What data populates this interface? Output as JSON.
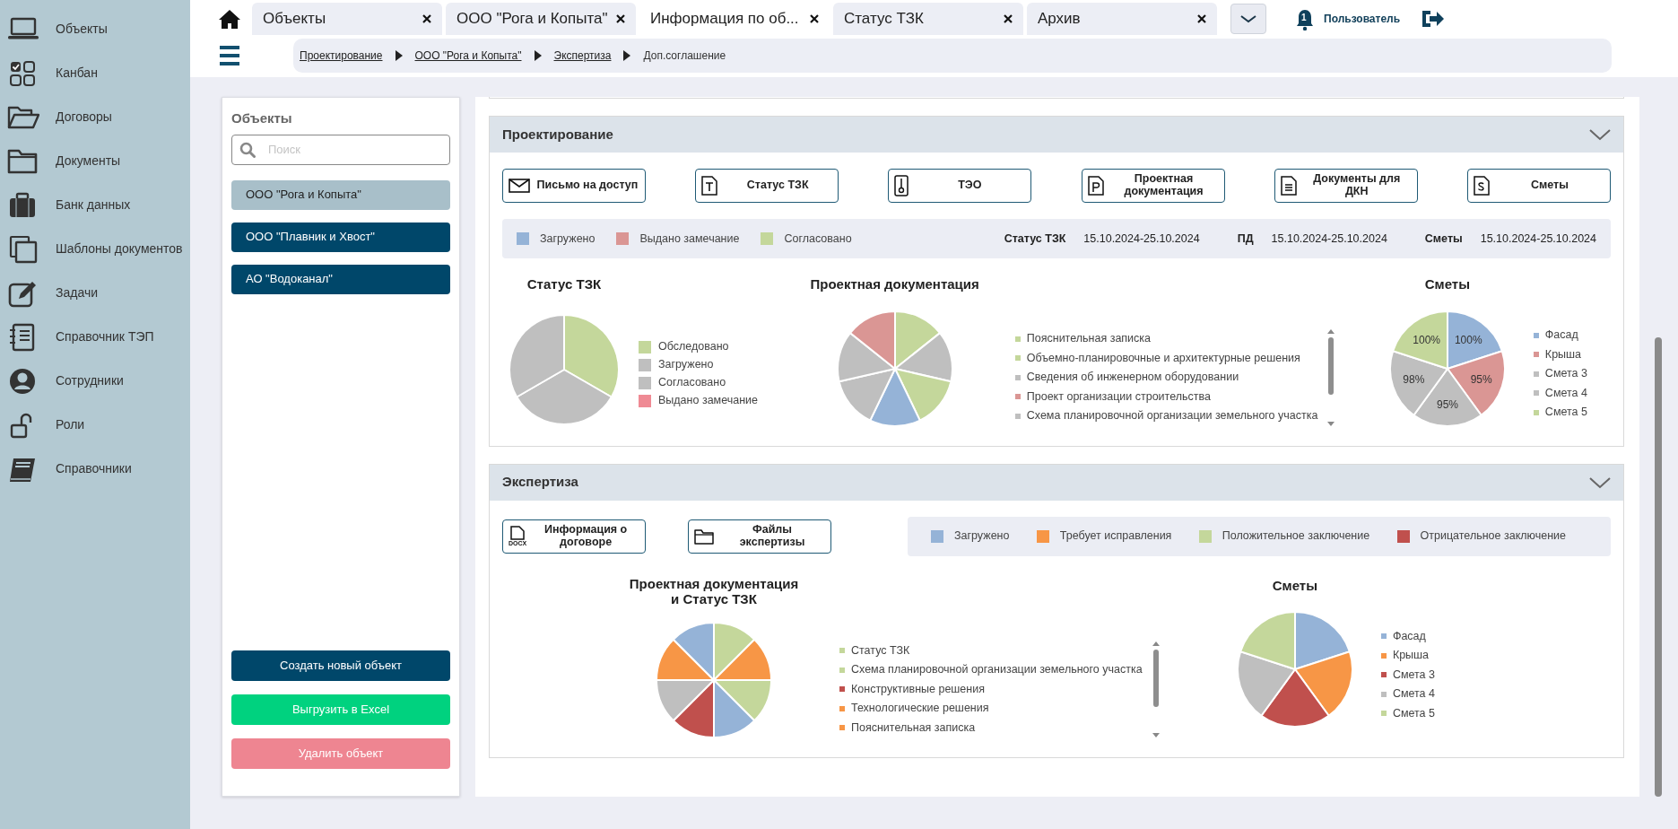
{
  "sidebar": {
    "items": [
      {
        "label": "Объекты"
      },
      {
        "label": "Канбан"
      },
      {
        "label": "Договоры"
      },
      {
        "label": "Документы"
      },
      {
        "label": "Банк данных"
      },
      {
        "label": "Шаблоны документов"
      },
      {
        "label": "Задачи"
      },
      {
        "label": "Справочник ТЭП"
      },
      {
        "label": "Сотрудники"
      },
      {
        "label": "Роли"
      },
      {
        "label": "Справочники"
      }
    ]
  },
  "tabs": [
    {
      "label": "Объекты",
      "selected": false
    },
    {
      "label": "ООО \"Рога и Копыта\"",
      "selected": false
    },
    {
      "label": "Информация по об...",
      "selected": true
    },
    {
      "label": "Статус ТЗК",
      "selected": false
    },
    {
      "label": "Архив",
      "selected": false
    }
  ],
  "header": {
    "notification_count": "1",
    "user": "Пользователь"
  },
  "breadcrumbs": [
    {
      "label": "Проектирование",
      "kind": "link"
    },
    {
      "label": "ООО \"Рога и Копыта\"",
      "kind": "link"
    },
    {
      "label": "Экспертиза",
      "kind": "link"
    },
    {
      "label": "Доп.соглашение",
      "kind": "current"
    }
  ],
  "objects_panel": {
    "title": "Объекты",
    "search": {
      "placeholder": "Поиск"
    },
    "items": [
      {
        "label": "ООО \"Рога и Копыта\"",
        "selected": true
      },
      {
        "label": "ООО \"Плавник и Хвост\"",
        "selected": false
      },
      {
        "label": "АО \"Водоканал\"",
        "selected": false
      }
    ],
    "actions": [
      {
        "label": "Создать новый объект",
        "kind": "primary"
      },
      {
        "label": "Выгрузить в Excel",
        "kind": "success"
      },
      {
        "label": "Удалить объект",
        "kind": "danger"
      }
    ]
  },
  "sections": [
    {
      "title": "Проектирование",
      "expanded": true,
      "buttons": [
        {
          "label": "Письмо на доступ"
        },
        {
          "label": "Статус ТЗК"
        },
        {
          "label": "ТЭО"
        },
        {
          "label": "Проектная документация"
        },
        {
          "label": "Документы для ДКН"
        },
        {
          "label": "Сметы"
        }
      ],
      "legend": [
        {
          "label": "Загружено",
          "color": "#95b3d7"
        },
        {
          "label": "Выдано замечание",
          "color": "#da9694"
        },
        {
          "label": "Согласовано",
          "color": "#c4d79b"
        }
      ],
      "periods": [
        {
          "label": "Статус ТЗК",
          "value": "15.10.2024-25.10.2024"
        },
        {
          "label": "ПД",
          "value": "15.10.2024-25.10.2024"
        },
        {
          "label": "Сметы",
          "value": "15.10.2024-25.10.2024"
        }
      ],
      "charts": [
        {
          "title": "Статус ТЗК",
          "kind": "block",
          "scrollable": false,
          "slices": [
            {
              "color": "#c4d79b"
            },
            {
              "color": "#bfbfbf"
            },
            {
              "color": "#bfbfbf"
            }
          ],
          "legend": [
            {
              "label": "Обследовано",
              "color": "#c4d79b"
            },
            {
              "label": "Загружено",
              "color": "#bfbfbf"
            },
            {
              "label": "Согласовано",
              "color": "#bfbfbf"
            },
            {
              "label": "Выдано замечание",
              "color": "#ef8a94"
            }
          ]
        },
        {
          "title": "Проектная документация",
          "kind": "list",
          "scrollable": true,
          "slices": [
            {
              "color": "#c4d79b"
            },
            {
              "color": "#bfbfbf"
            },
            {
              "color": "#c4d79b"
            },
            {
              "color": "#95b3d7"
            },
            {
              "color": "#bfbfbf"
            },
            {
              "color": "#bfbfbf"
            },
            {
              "color": "#da9694"
            }
          ],
          "legend": [
            {
              "label": "Пояснительная записка",
              "color": "#c4d79b"
            },
            {
              "label": "Объемно-планировочные и архитектурные решения",
              "color": "#c4d79b"
            },
            {
              "label": "Сведения об инженерном оборудовании",
              "color": "#bfbfbf"
            },
            {
              "label": "Проект организации строительства",
              "color": "#da9694"
            },
            {
              "label": "Схема планировочной организации земельного участка",
              "color": "#bfbfbf"
            }
          ]
        },
        {
          "title": "Сметы",
          "kind": "list",
          "scrollable": false,
          "slices": [
            {
              "color": "#95b3d7",
              "label": "100%"
            },
            {
              "color": "#da9694",
              "label": "95%"
            },
            {
              "color": "#bfbfbf",
              "label": "95%"
            },
            {
              "color": "#bfbfbf",
              "label": "98%"
            },
            {
              "color": "#c4d79b",
              "label": "100%"
            }
          ],
          "legend": [
            {
              "label": "Фасад",
              "color": "#95b3d7"
            },
            {
              "label": "Крыша",
              "color": "#da9694"
            },
            {
              "label": "Смета 3",
              "color": "#bfbfbf"
            },
            {
              "label": "Смета 4",
              "color": "#bfbfbf"
            },
            {
              "label": "Смета 5",
              "color": "#c4d79b"
            }
          ]
        }
      ]
    },
    {
      "title": "Экспертиза",
      "expanded": true,
      "buttons": [
        {
          "label": "Информация о договоре",
          "icon_label": "DOCX"
        },
        {
          "label": "Файлы экспертизы"
        }
      ],
      "legend": [
        {
          "label": "Загружено",
          "color": "#95b3d7"
        },
        {
          "label": "Требует исправления",
          "color": "#f79646"
        },
        {
          "label": "Положительное заключение",
          "color": "#c4d79b"
        },
        {
          "label": "Отрицательное заключение",
          "color": "#c0504d"
        }
      ],
      "charts": [
        {
          "title": "Проектная документация и Статус ТЗК",
          "kind": "list",
          "scrollable": true,
          "slices": [
            {
              "color": "#c4d79b"
            },
            {
              "color": "#f79646"
            },
            {
              "color": "#c4d79b"
            },
            {
              "color": "#95b3d7"
            },
            {
              "color": "#c0504d"
            },
            {
              "color": "#bfbfbf"
            },
            {
              "color": "#f79646"
            },
            {
              "color": "#95b3d7"
            }
          ],
          "legend": [
            {
              "label": "Статус ТЗК",
              "color": "#c4d79b"
            },
            {
              "label": "Схема планировочной организации земельного участка",
              "color": "#c4d79b"
            },
            {
              "label": "Конструктивные решения",
              "color": "#c0504d"
            },
            {
              "label": "Технологические решения",
              "color": "#f79646"
            },
            {
              "label": "Пояснительная записка",
              "color": "#f79646"
            }
          ]
        },
        {
          "title": "Сметы",
          "kind": "list",
          "scrollable": false,
          "slices": [
            {
              "color": "#95b3d7"
            },
            {
              "color": "#f79646"
            },
            {
              "color": "#c0504d"
            },
            {
              "color": "#bfbfbf"
            },
            {
              "color": "#c4d79b"
            }
          ],
          "legend": [
            {
              "label": "Фасад",
              "color": "#95b3d7"
            },
            {
              "label": "Крыша",
              "color": "#f79646"
            },
            {
              "label": "Смета 3",
              "color": "#c0504d"
            },
            {
              "label": "Смета 4",
              "color": "#bfbfbf"
            },
            {
              "label": "Смета 5",
              "color": "#c4d79b"
            }
          ]
        }
      ]
    }
  ]
}
